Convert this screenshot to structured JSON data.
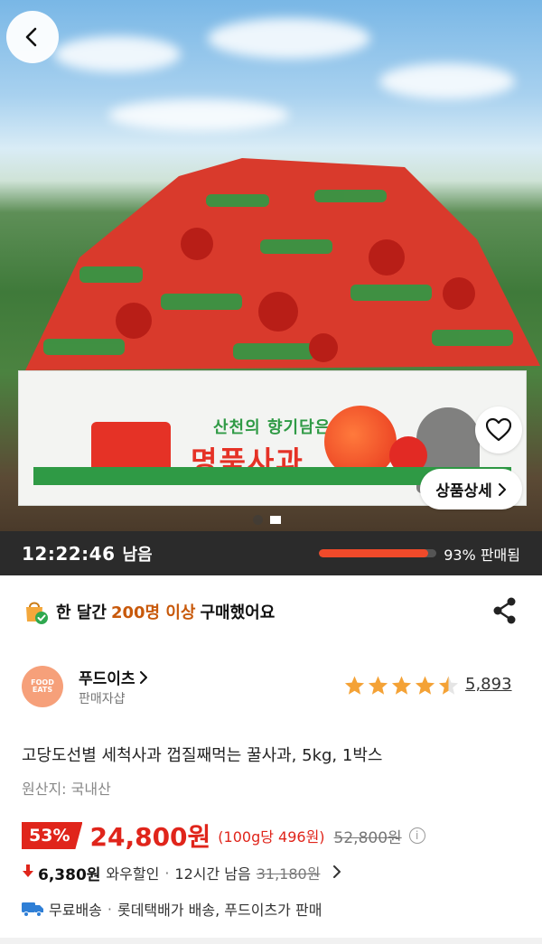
{
  "hero": {
    "box_brand_line1": "산천의 향기담은",
    "box_brand_line2": "명품사과",
    "detail_button": "상품상세"
  },
  "timer": {
    "time": "12:22:46",
    "remain_label": "남음",
    "sold_percent": 93,
    "sold_text": "93% 판매됨"
  },
  "purchase": {
    "prefix": "한 달간",
    "highlight": "200명 이상",
    "suffix": "구매했어요"
  },
  "seller": {
    "logo_text": "FOOD EATS",
    "name": "푸드이츠",
    "type": "판매자샵",
    "rating": 4.5,
    "review_count": "5,893"
  },
  "product": {
    "title": "고당도선별 세척사과 껍질째먹는 꿀사과, 5kg, 1박스",
    "origin": "원산지: 국내산"
  },
  "price": {
    "discount": "53%",
    "sale_price": "24,800원",
    "unit_price": "(100g당 496원)",
    "original_price": "52,800원"
  },
  "wow": {
    "amount": "6,380원",
    "label": "와우할인",
    "time_left": "12시간 남음",
    "original": "31,180원"
  },
  "shipping": {
    "free": "무료배송",
    "carrier": "롯데택배가 배송, 푸드이츠가 판매"
  },
  "colors": {
    "accent_red": "#e0251b",
    "highlight_orange": "#c8590b",
    "timer_bg": "#2b2b2b",
    "progress_fill": "#f04a2a",
    "star": "#f4a236"
  }
}
